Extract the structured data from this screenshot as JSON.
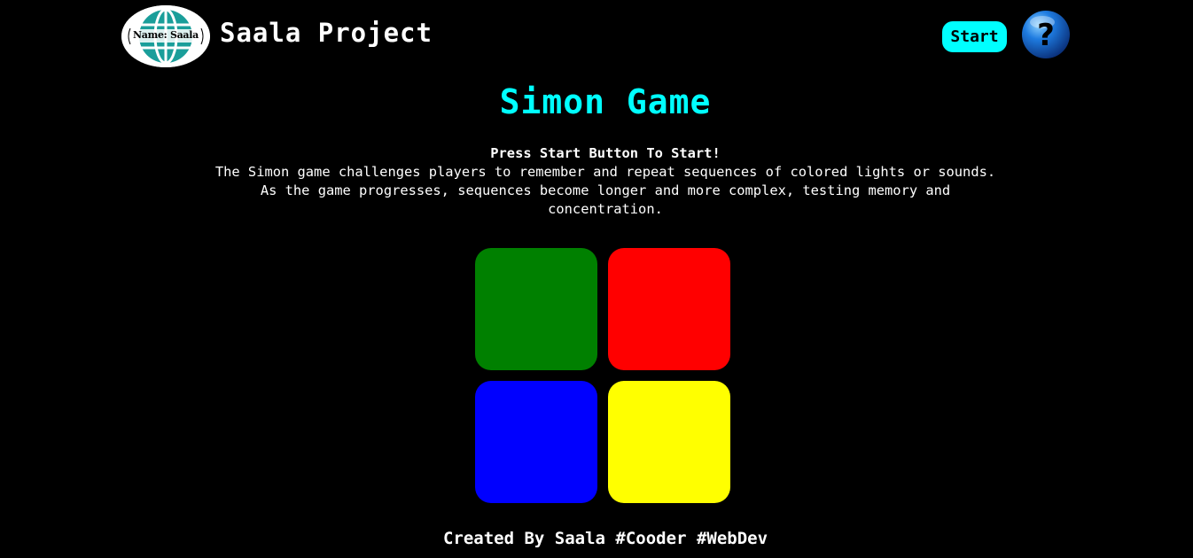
{
  "header": {
    "logo_text": "Name: Saala",
    "brand": "Saala Project",
    "start_label": "Start",
    "help_icon": "question-mark-icon"
  },
  "main": {
    "title": "Simon Game",
    "lead": "Press Start Button To Start!",
    "description_lines": [
      "The Simon game challenges players to remember and repeat sequences of colored lights or sounds.",
      "As the game progresses, sequences become longer and more complex, testing memory and",
      "concentration."
    ]
  },
  "pads": {
    "green": "#008000",
    "red": "#ff0000",
    "blue": "#0000ff",
    "yellow": "#ffff00"
  },
  "colors": {
    "accent": "#00ffff",
    "background": "#000000",
    "text": "#ffffff"
  },
  "footer": {
    "credit": "Created By Saala #Cooder #WebDev"
  }
}
